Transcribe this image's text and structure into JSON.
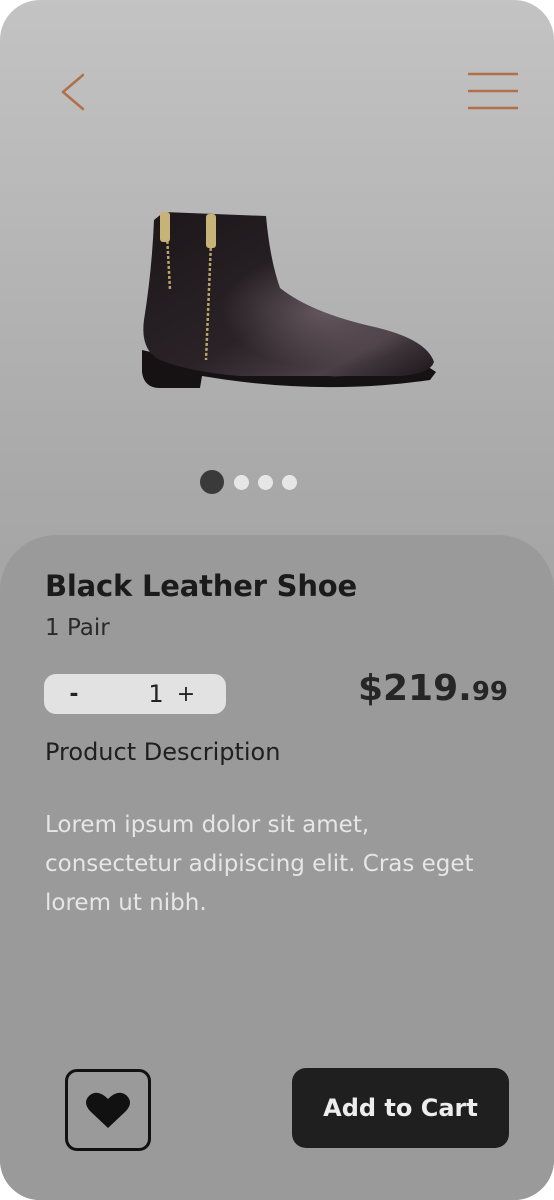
{
  "nav": {
    "back_icon": "chevron-left-icon",
    "menu_icon": "hamburger-menu-icon",
    "accent_color": "#b0704a"
  },
  "product": {
    "name": "Black Leather Shoe",
    "unit": "1 Pair",
    "image_icon": "ankle-boot-icon",
    "carousel": {
      "total": 4,
      "active": 1
    }
  },
  "quantity": {
    "minus_label": "-",
    "value": "1",
    "plus_label": "+"
  },
  "price": {
    "main": "$219.",
    "cents": "99"
  },
  "description": {
    "heading": "Product Description",
    "body": "Lorem ipsum dolor sit amet, consectetur adipiscing elit. Cras eget lorem ut nibh."
  },
  "actions": {
    "favorite_icon": "heart-icon",
    "add_to_cart_label": "Add to Cart"
  }
}
